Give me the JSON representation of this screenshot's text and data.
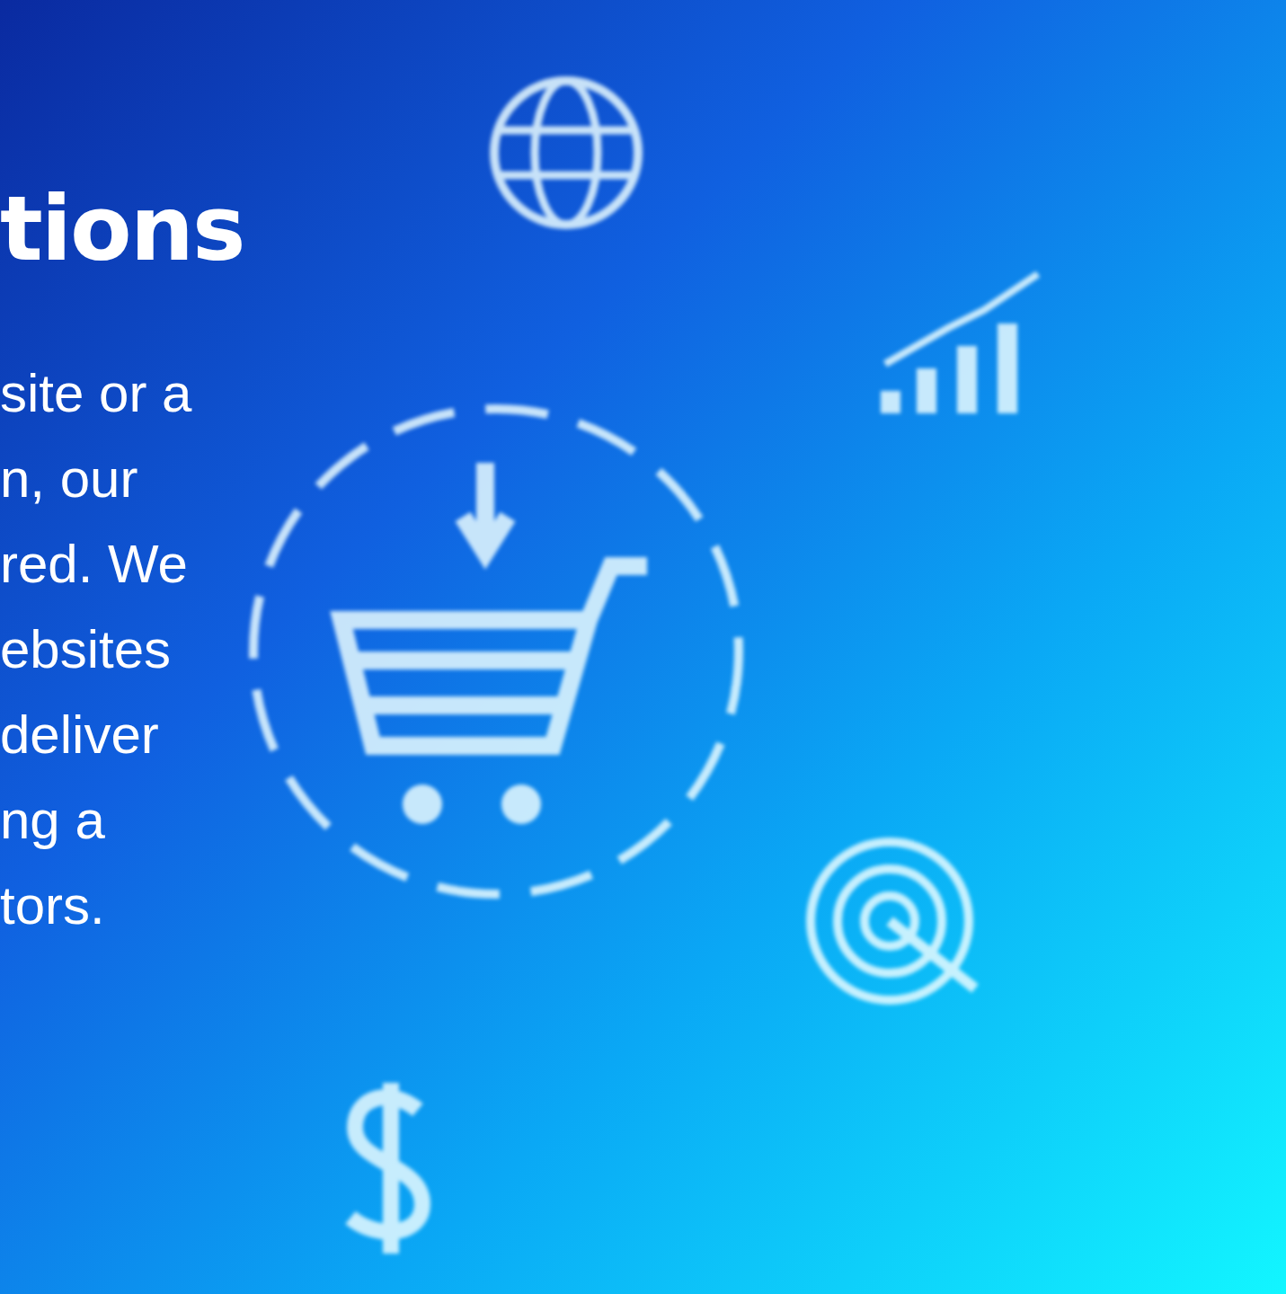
{
  "hero": {
    "heading": "tions",
    "paragraph_lines": [
      "site or a",
      "n, our",
      "red. We",
      "ebsites",
      "deliver",
      "ng a",
      "tors."
    ]
  }
}
